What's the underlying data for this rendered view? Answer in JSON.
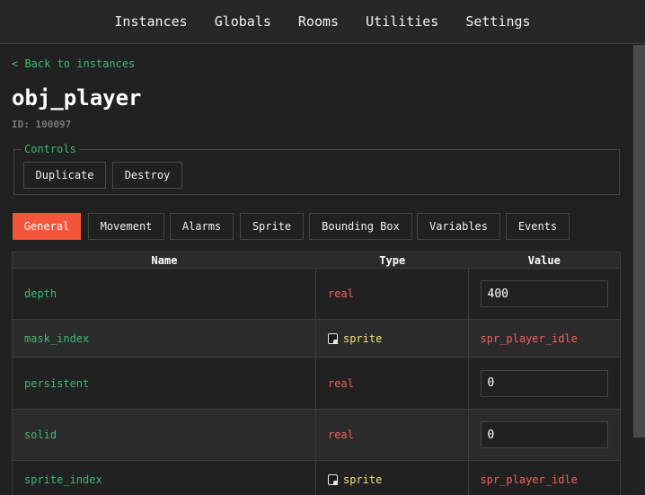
{
  "nav": {
    "items": [
      "Instances",
      "Globals",
      "Rooms",
      "Utilities",
      "Settings"
    ]
  },
  "back_link": "< Back to instances",
  "object": {
    "name": "obj_player",
    "id_label": "ID: 100097"
  },
  "controls": {
    "legend": "Controls",
    "duplicate": "Duplicate",
    "destroy": "Destroy"
  },
  "tabs": {
    "active": "General",
    "items": [
      "General",
      "Movement",
      "Alarms",
      "Sprite",
      "Bounding Box",
      "Variables",
      "Events"
    ]
  },
  "table": {
    "headers": [
      "Name",
      "Type",
      "Value"
    ],
    "rows": [
      {
        "name": "depth",
        "type": "real",
        "value": "400",
        "kind": "input"
      },
      {
        "name": "mask_index",
        "type": "sprite",
        "value": "spr_player_idle",
        "kind": "ref"
      },
      {
        "name": "persistent",
        "type": "real",
        "value": "0",
        "kind": "input"
      },
      {
        "name": "solid",
        "type": "real",
        "value": "0",
        "kind": "input"
      },
      {
        "name": "sprite_index",
        "type": "sprite",
        "value": "spr_player_idle",
        "kind": "ref"
      }
    ]
  },
  "colors": {
    "accent": "#f4553a",
    "link_green": "#3cb878",
    "type_real": "#f06060",
    "type_sprite": "#ede27a"
  }
}
